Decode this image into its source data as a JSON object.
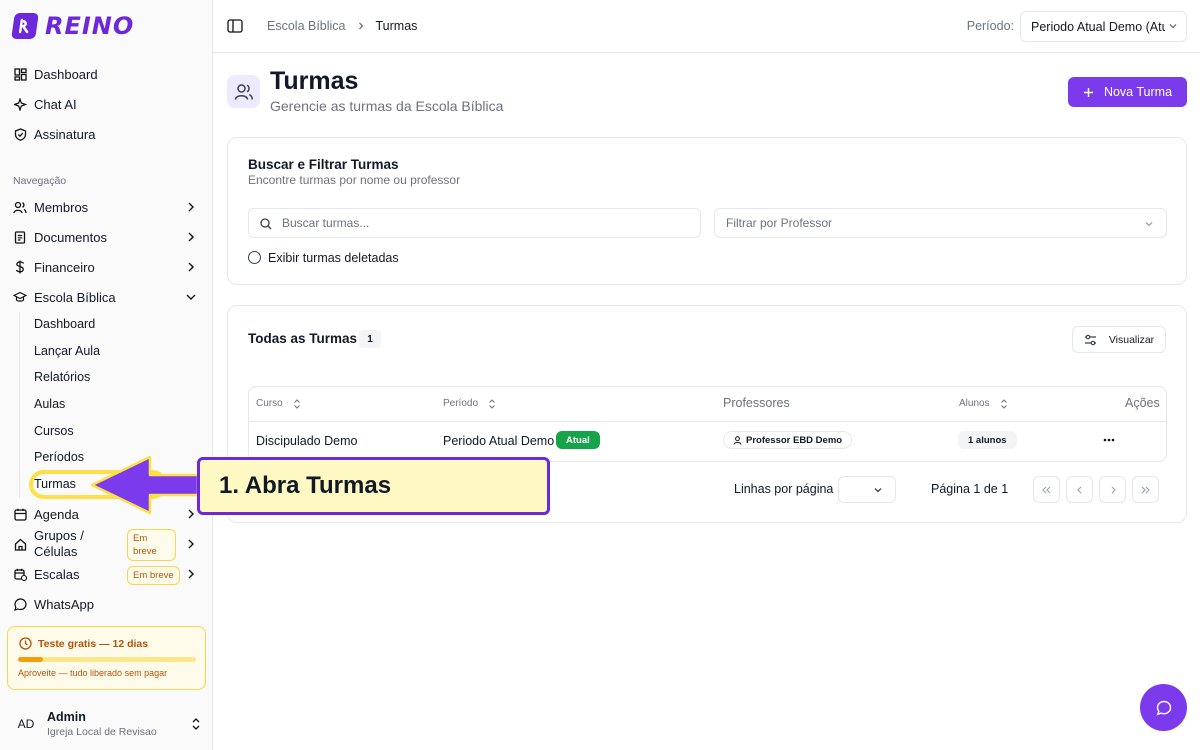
{
  "app": {
    "logo_text": "REINO",
    "brand_color": "#6d28d9",
    "accent_color": "#7c3aed"
  },
  "sidebar": {
    "top_items": [
      {
        "label": "Dashboard",
        "icon": "dashboard-icon"
      },
      {
        "label": "Chat AI",
        "icon": "sparkles-icon"
      },
      {
        "label": "Assinatura",
        "icon": "shield-icon"
      }
    ],
    "section_label": "Navegação",
    "nav_items": [
      {
        "label": "Membros",
        "icon": "users-icon"
      },
      {
        "label": "Documentos",
        "icon": "document-icon"
      },
      {
        "label": "Financeiro",
        "icon": "dollar-icon"
      },
      {
        "label": "Escola Bíblica",
        "icon": "graduation-cap-icon"
      }
    ],
    "sub_items": [
      "Dashboard",
      "Lançar Aula",
      "Relatórios",
      "Aulas",
      "Cursos",
      "Períodos",
      "Turmas"
    ],
    "more_items": [
      {
        "label": "Agenda",
        "icon": "calendar-icon"
      },
      {
        "label": "Grupos / Células",
        "icon": "home-icon",
        "badge": "Em breve"
      },
      {
        "label": "Escalas",
        "icon": "calendar-clock-icon",
        "badge": "Em breve"
      },
      {
        "label": "WhatsApp",
        "icon": "chat-bubble-icon"
      }
    ],
    "trial": {
      "title": "Teste gratis — 12 dias",
      "note": "Aproveite — tudo liberado sem pagar",
      "progress": 0.14
    },
    "user": {
      "initials": "AD",
      "name": "Admin",
      "org": "Igreja Local de Revisao"
    }
  },
  "topbar": {
    "breadcrumb": [
      "Escola Bíblica",
      "Turmas"
    ],
    "period_label": "Período:",
    "period_value": "Periodo Atual Demo (Atual)"
  },
  "header": {
    "title": "Turmas",
    "subtitle": "Gerencie as turmas da Escola Bíblica",
    "new_button": "Nova Turma"
  },
  "filters": {
    "title": "Buscar e Filtrar Turmas",
    "description": "Encontre turmas por nome ou professor",
    "search_placeholder": "Buscar turmas...",
    "professor_placeholder": "Filtrar por Professor",
    "show_deleted_label": "Exibir turmas deletadas"
  },
  "table": {
    "title": "Todas as Turmas",
    "count": "1",
    "view_button": "Visualizar",
    "columns": {
      "course": "Curso",
      "period": "Período",
      "teachers": "Professores",
      "students": "Alunos",
      "actions": "Ações"
    },
    "rows": [
      {
        "course": "Discipulado Demo",
        "period": "Periodo Atual Demo",
        "status": "Atual",
        "teacher": "Professor EBD Demo",
        "students": "1 alunos"
      }
    ]
  },
  "pagination": {
    "rows_per_page_label": "Linhas por página",
    "page_info": "Página 1 de 1"
  },
  "annotation": {
    "callout": "1. Abra Turmas",
    "highlight_color": "#fde047"
  }
}
